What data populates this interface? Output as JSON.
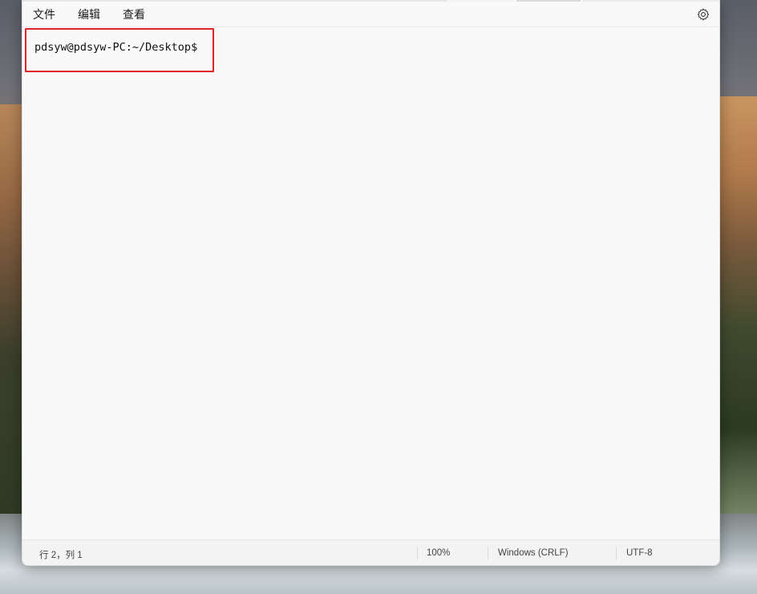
{
  "menu": {
    "file": "文件",
    "edit": "编辑",
    "view": "查看"
  },
  "editor": {
    "line1": "pdsyw@pdsyw-PC:~/Desktop$"
  },
  "status": {
    "position": "行 2，列 1",
    "zoom": "100%",
    "line_ending": "Windows (CRLF)",
    "encoding": "UTF-8"
  },
  "icons": {
    "settings": "gear-icon"
  },
  "colors": {
    "highlight": "#e0202a",
    "window_bg": "#f9f9f9"
  }
}
